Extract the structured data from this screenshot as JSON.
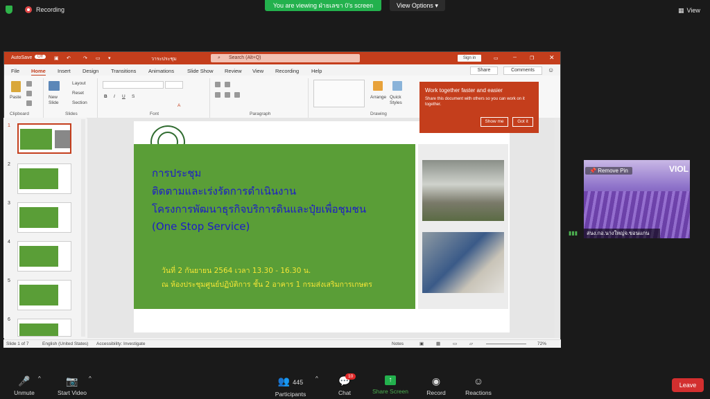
{
  "zoom": {
    "recording_label": "Recording",
    "viewing_banner": "You are viewing ฝ่ายเลขา 0's screen",
    "view_options": "View Options",
    "view_button": "View",
    "participant_name": "สนง.กอ.นางใหญ่จ.ขอนแกน",
    "remove_pin": "Remove Pin",
    "video_brand": "VIOL",
    "toolbar": {
      "unmute": "Unmute",
      "start_video": "Start Video",
      "participants": "Participants",
      "participants_count": "445",
      "chat": "Chat",
      "chat_badge": "10",
      "share_screen": "Share Screen",
      "record": "Record",
      "reactions": "Reactions",
      "leave": "Leave"
    }
  },
  "powerpoint": {
    "autosave": "AutoSave",
    "autosave_state": "Off",
    "file_name": "วาระประชุม",
    "search_placeholder": "Search (Alt+Q)",
    "sign_in": "Sign in",
    "menu": [
      "File",
      "Home",
      "Insert",
      "Design",
      "Transitions",
      "Animations",
      "Slide Show",
      "Review",
      "View",
      "Recording",
      "Help"
    ],
    "share": "Share",
    "comments": "Comments",
    "ribbon_groups": {
      "clipboard": "Clipboard",
      "slides": "Slides",
      "font": "Font",
      "paragraph": "Paragraph",
      "drawing": "Drawing"
    },
    "ribbon_labels": {
      "paste": "Paste",
      "new_slide": "New Slide",
      "layout": "Layout",
      "reset": "Reset",
      "section": "Section",
      "arrange": "Arrange",
      "quick_styles": "Quick Styles"
    },
    "popup": {
      "title": "Work together faster and easier",
      "body": "Share this document with others so you can work on it together.",
      "show_me": "Show me",
      "got_it": "Got it"
    },
    "thumbnails": [
      "1",
      "2",
      "3",
      "4",
      "5",
      "6"
    ],
    "slide": {
      "line1": "การประชุม",
      "line2": "ติดตามและเร่งรัดการดำเนินงาน",
      "line3": "โครงการพัฒนาธุรกิจบริการดินและปุ๋ยเพื่อชุมชน",
      "line4": "(One Stop Service)",
      "date": "วันที่ 2 กันยายน 2564 เวลา 13.30 - 16.30 น.",
      "place": "ณ ห้องประชุมศูนย์ปฏิบัติการ ชั้น 2 อาคาร 1 กรมส่งเสริมการเกษตร"
    },
    "status": {
      "slide_of": "Slide 1 of 7",
      "language": "English (United States)",
      "accessibility": "Accessibility: Investigate",
      "notes": "Notes",
      "zoom": "72%"
    }
  }
}
